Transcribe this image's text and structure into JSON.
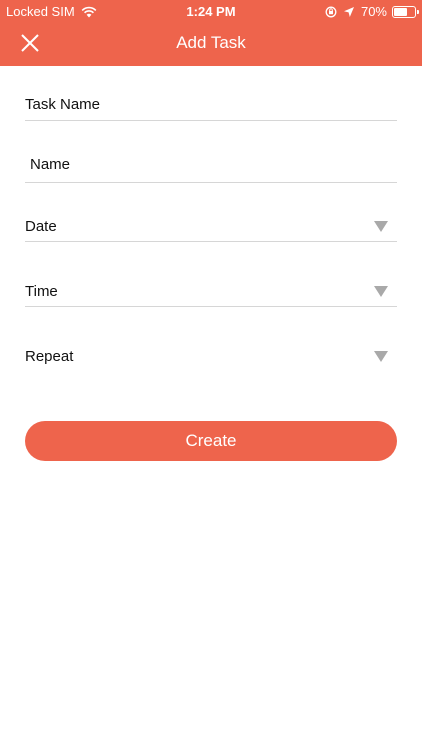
{
  "status_bar": {
    "carrier": "Locked SIM",
    "time": "1:24 PM",
    "battery_percent_label": "70%",
    "battery_level": 0.7
  },
  "header": {
    "title": "Add Task",
    "close_icon": "close-icon"
  },
  "form": {
    "task_name_label": "Task Name",
    "name_placeholder": "Name",
    "date_label": "Date",
    "time_label": "Time",
    "repeat_label": "Repeat",
    "dropdown_icon": "dropdown-arrow-icon"
  },
  "actions": {
    "create_label": "Create"
  },
  "colors": {
    "accent": "#EE644C",
    "divider": "#D6D6D6",
    "arrow": "#A9A9A9"
  }
}
